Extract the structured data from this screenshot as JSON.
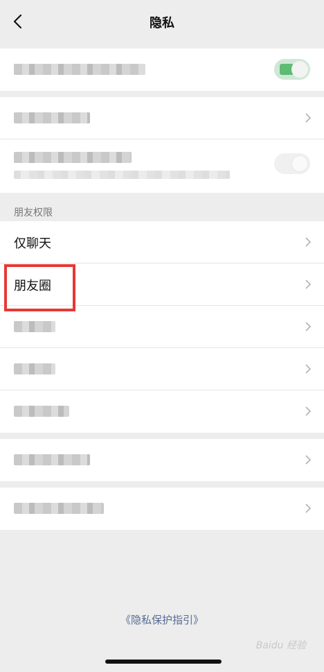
{
  "nav": {
    "title": "隐私",
    "back_icon": "chevron-left-icon"
  },
  "section": {
    "friend_permissions": "朋友权限"
  },
  "friend_rows": [
    {
      "label": "仅聊天"
    },
    {
      "label": "朋友圈"
    }
  ],
  "footer": {
    "guide_link": "《隐私保护指引》",
    "watermark": "Baidu 经验"
  },
  "colors": {
    "highlight": "#e53935",
    "link": "#576b95",
    "toggle_on": "#5dbb74"
  }
}
